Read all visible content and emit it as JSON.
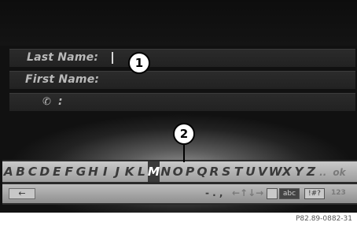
{
  "form": {
    "last_name_label": "Last Name:",
    "first_name_label": "First Name:",
    "phone_label": ":"
  },
  "callouts": {
    "c1": "1",
    "c2": "2"
  },
  "keyboard": {
    "letters": [
      "A",
      "B",
      "C",
      "D",
      "E",
      "F",
      "G",
      "H",
      "I",
      "J",
      "K",
      "L",
      "M",
      "N",
      "O",
      "P",
      "Q",
      "R",
      "S",
      "T",
      "U",
      "V",
      "W",
      "X",
      "Y",
      "Z"
    ],
    "selected_letter": "M",
    "more_label": "..",
    "dim_label": "ok",
    "controls": {
      "back_label": "",
      "punct_label": "- . ,",
      "arrows_label": "←↑↓→",
      "case_label": "abc",
      "digits_label": "!#?",
      "tail_label": "123"
    }
  },
  "caption": "P82.89-0882-31"
}
